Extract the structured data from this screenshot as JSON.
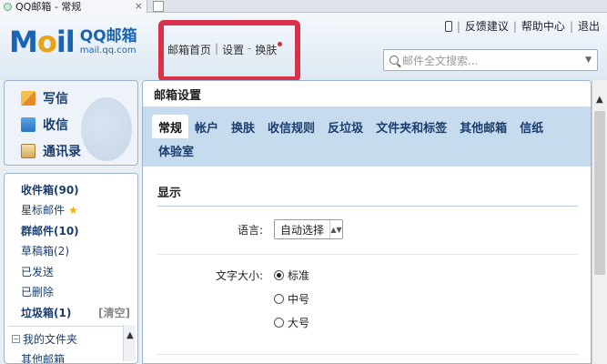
{
  "browser": {
    "tab_title": "QQ邮箱 - 常规",
    "tab_close": "×"
  },
  "header": {
    "logo_main": "M",
    "logo_o": "o",
    "logo_rest": "il",
    "logo_cn": "QQ邮箱",
    "logo_url": "mail.qq.com",
    "nav": {
      "home": "邮箱首页",
      "settings": "设置",
      "separator_dash": "-",
      "skin": "换肤",
      "separator": "|"
    },
    "top_links": {
      "feedback": "反馈建议",
      "help": "帮助中心",
      "logout": "退出",
      "separator": "|"
    },
    "search": {
      "placeholder": "邮件全文搜索...",
      "caret": "▼"
    }
  },
  "sidebar": {
    "compose": [
      {
        "label": "写信",
        "icon": "write-icon"
      },
      {
        "label": "收信",
        "icon": "receive-icon"
      },
      {
        "label": "通讯录",
        "icon": "contacts-icon"
      }
    ],
    "folders": {
      "inbox": "收件箱(90)",
      "starred": "星标邮件",
      "group": "群邮件(10)",
      "drafts": "草稿箱(2)",
      "sent": "已发送",
      "deleted": "已删除",
      "spam": "垃圾箱(1)",
      "spam_clear": "[清空]",
      "my_folders": "我的文件夹",
      "my_folders_toggle": "−",
      "other_mailboxes": "其他邮箱"
    }
  },
  "main": {
    "title": "邮箱设置",
    "tabs": [
      "常规",
      "帐户",
      "换肤",
      "收信规则",
      "反垃圾",
      "文件夹和标签",
      "其他邮箱",
      "信纸",
      "体验室"
    ],
    "active_tab": "常规",
    "section_title": "显示",
    "language": {
      "label": "语言:",
      "value": "自动选择",
      "arrow": "▲▼"
    },
    "font_size": {
      "label": "文字大小:",
      "options": [
        "标准",
        "中号",
        "大号"
      ],
      "selected": "标准"
    }
  },
  "icons": {
    "star": "★",
    "scroll_up": "▲"
  }
}
